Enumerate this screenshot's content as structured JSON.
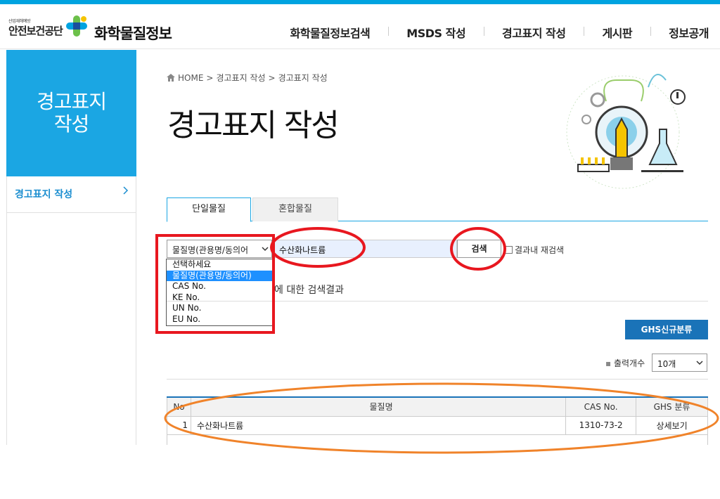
{
  "header": {
    "org_small": "산업재해예방",
    "org_name": "안전보건공단",
    "site_title": "화학물질정보",
    "nav": [
      "화학물질정보검색",
      "MSDS 작성",
      "경고표지 작성",
      "게시판",
      "정보공개"
    ]
  },
  "sidebar": {
    "heading_line1": "경고표지",
    "heading_line2": "작성",
    "items": [
      {
        "label": "경고표지 작성"
      }
    ]
  },
  "breadcrumb": {
    "home": "HOME",
    "sep": ">",
    "items": [
      "경고표지 작성",
      "경고표지 작성"
    ]
  },
  "page_title": "경고표지 작성",
  "tabs": [
    {
      "label": "단일물질",
      "active": true
    },
    {
      "label": "혼합물질",
      "active": false
    }
  ],
  "search": {
    "type_selected": "물질명(관용명/동의어",
    "options": [
      "선택하세요",
      "물질명(관용명/동의어)",
      "CAS No.",
      "KE No.",
      "UN No.",
      "EU No."
    ],
    "highlighted_option": 1,
    "query": "수산화나트륨",
    "button_label": "검색",
    "recheck_label": "결과내 재검색"
  },
  "result_header": "에 대한 검색결과",
  "ghs_button": "GHS신규분류",
  "per_page": {
    "label": "출력개수",
    "value": "10개"
  },
  "table": {
    "columns": [
      "No",
      "물질명",
      "CAS No.",
      "GHS 분류"
    ],
    "rows": [
      {
        "no": "1",
        "name": "수산화나트륨",
        "cas": "1310-73-2",
        "ghs": "상세보기"
      }
    ]
  },
  "colors": {
    "brand_blue": "#1ba6e3",
    "button_blue": "#1a73b8",
    "annotation_red": "#e8171f",
    "annotation_orange": "#f0832a"
  }
}
